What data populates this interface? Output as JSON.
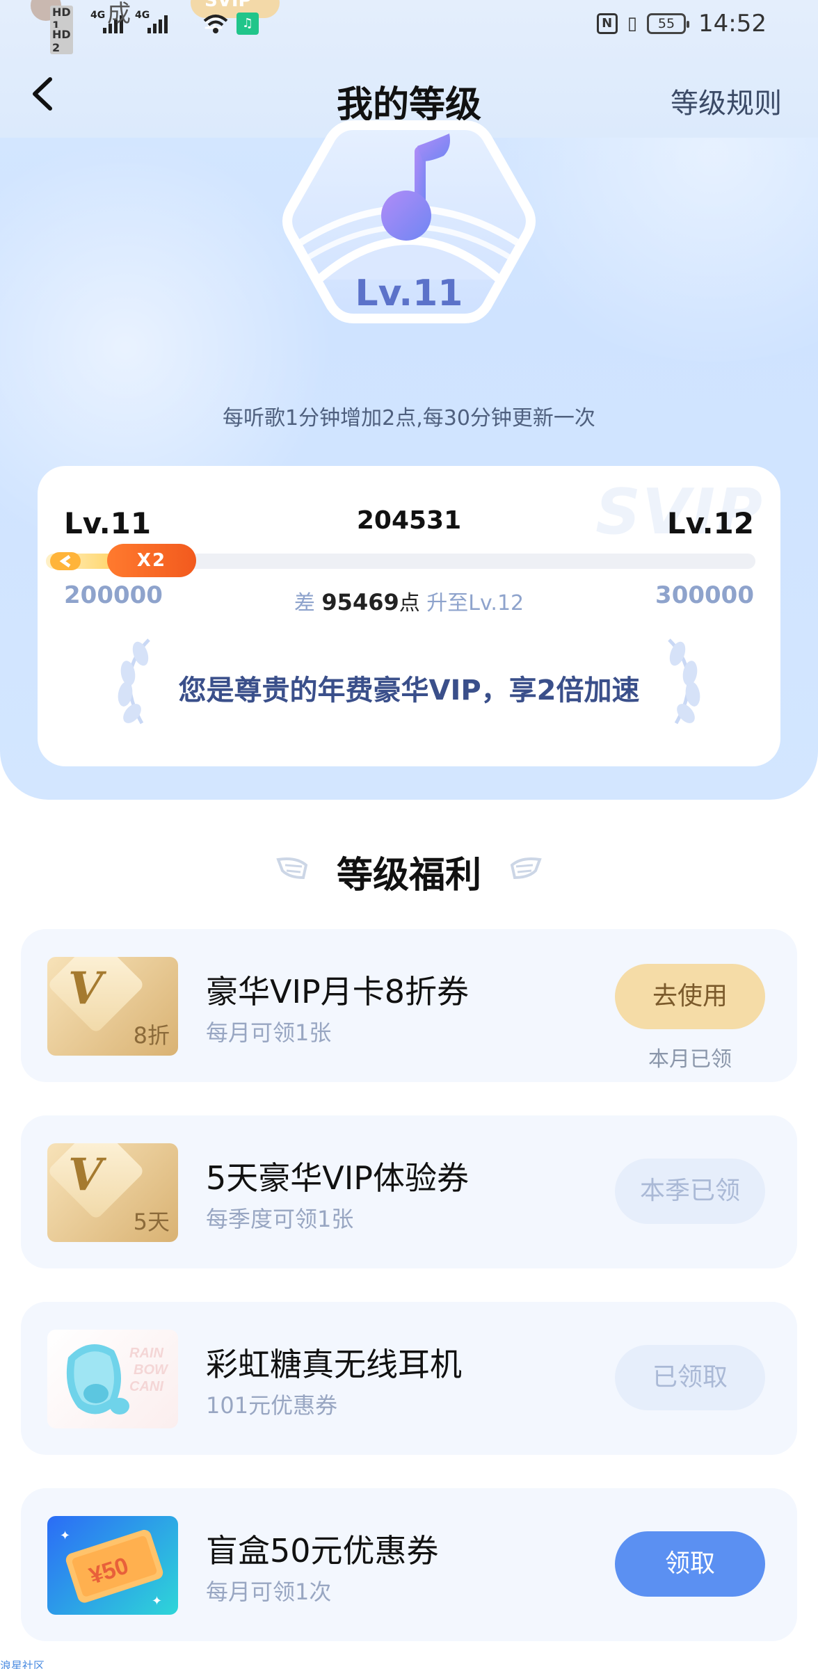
{
  "status_bar": {
    "carrier_text": "成",
    "svip_badge": "SVIP年",
    "hd1": "HD 1",
    "hd2": "HD 2",
    "net1": "4G",
    "net2": "4G",
    "nfc": "N",
    "battery": "55",
    "time": "14:52"
  },
  "nav": {
    "title": "我的等级",
    "rules_link": "等级规则"
  },
  "badge": {
    "level_text": "Lv.11"
  },
  "tip": "每听歌1分钟增加2点,每30分钟更新一次",
  "level_card": {
    "watermark": "SVIP",
    "current_level": "Lv.11",
    "next_level": "Lv.12",
    "current_points": "204531",
    "progress_fraction": 0.045,
    "boost_label": "X2",
    "start_points": "200000",
    "end_points": "300000",
    "gap_prefix": "差",
    "gap_value": "95469",
    "gap_unit": "点",
    "gap_suffix": "升至Lv.12",
    "vip_message": "您是尊贵的年费豪华VIP，享2倍加速"
  },
  "benefits": {
    "title": "等级福利",
    "items": [
      {
        "title": "豪华VIP月卡8折券",
        "subtitle": "每月可领1张",
        "thumb_tag": "8折",
        "button": "去使用",
        "note": "本月已领"
      },
      {
        "title": "5天豪华VIP体验券",
        "subtitle": "每季度可领1张",
        "thumb_tag": "5天",
        "button": "本季已领"
      },
      {
        "title": "彩虹糖真无线耳机",
        "subtitle": "101元优惠券",
        "thumb_text": "RAIN BOW CANI",
        "button": "已领取"
      },
      {
        "title": "盲盒50元优惠券",
        "subtitle": "每月可领1次",
        "thumb_text": "¥50",
        "button": "领取"
      }
    ]
  },
  "footer_mark": "浪星社区",
  "colors": {
    "accent_blue": "#5b90f2",
    "gold": "#f5dca7",
    "level_blue": "#5b72c9"
  }
}
